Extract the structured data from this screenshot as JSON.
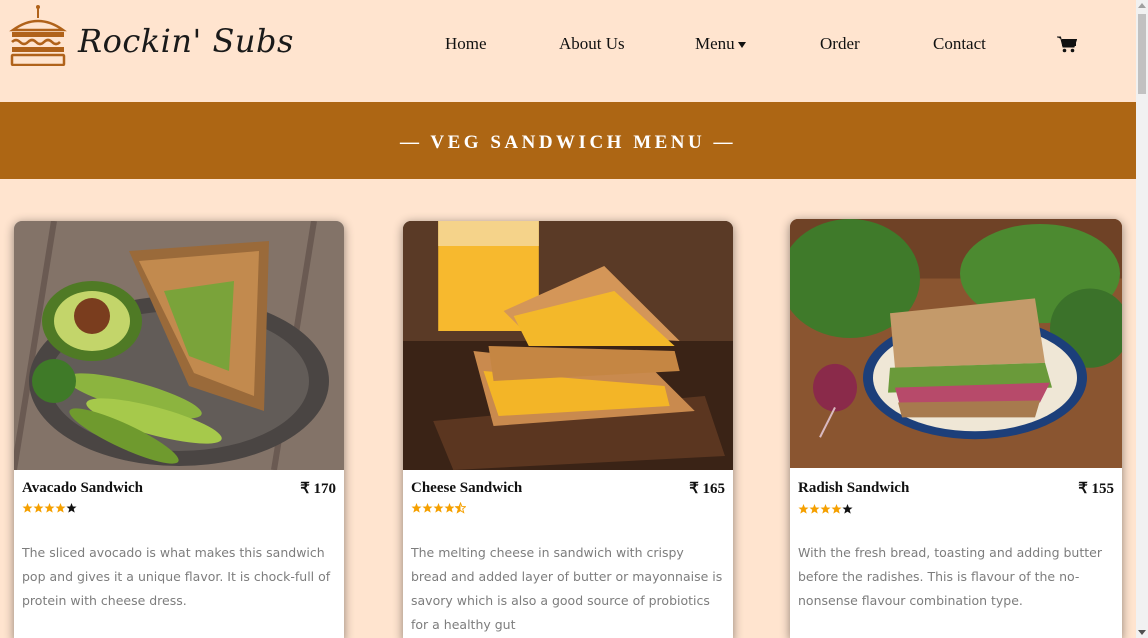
{
  "brand": {
    "name": "Rockin' Subs",
    "logo_icon": "sandwich-logo-icon"
  },
  "nav": {
    "home": "Home",
    "about": "About Us",
    "menu": "Menu",
    "order": "Order",
    "contact": "Contact",
    "cart_icon": "cart-icon"
  },
  "banner": {
    "title": "— VEG SANDWICH MENU —"
  },
  "colors": {
    "banner": "#ad6614",
    "page_bg": "#ffe4cf",
    "star": "#f5a000"
  },
  "cards": [
    {
      "name": "Avacado Sandwich",
      "price": "₹ 170",
      "rating": 4,
      "description": "The sliced avocado is what makes this sandwich pop and gives it a unique flavor. It is chock-full of protein with cheese dress."
    },
    {
      "name": "Cheese Sandwich",
      "price": "₹ 165",
      "rating": 4.5,
      "description": "The melting cheese in sandwich with crispy bread and added layer of butter or mayonnaise is savory which is also a good source of probiotics for a healthy gut"
    },
    {
      "name": "Radish Sandwich",
      "price": "₹ 155",
      "rating": 4,
      "description": "With the fresh bread, toasting and adding butter before the radishes. This is flavour of the no-nonsense flavour combination type."
    }
  ]
}
